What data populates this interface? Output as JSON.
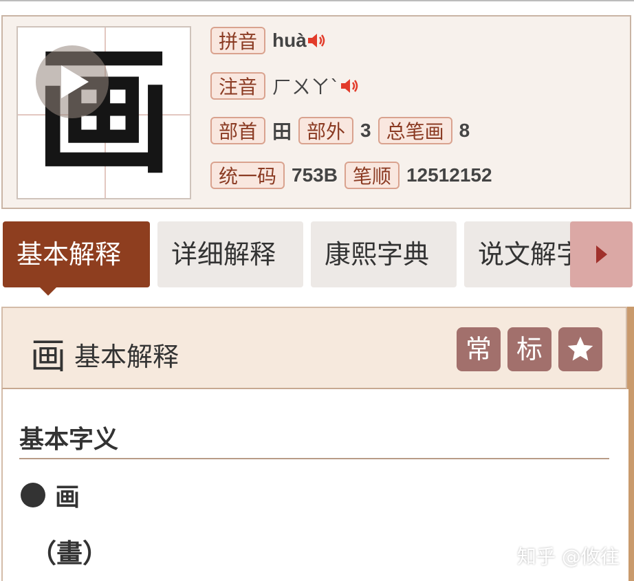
{
  "character": {
    "glyph": "画",
    "pinyin_label": "拼音",
    "pinyin": "huà",
    "zhuyin_label": "注音",
    "zhuyin": "ㄏㄨㄚˋ",
    "radical_label": "部首",
    "radical": "田",
    "outer_strokes_label": "部外",
    "outer_strokes": "3",
    "total_strokes_label": "总笔画",
    "total_strokes": "8",
    "unicode_label": "统一码",
    "unicode": "753B",
    "stroke_order_label": "笔顺",
    "stroke_order": "12512152"
  },
  "tabs": [
    {
      "label": "基本解释",
      "active": true
    },
    {
      "label": "详细解释",
      "active": false
    },
    {
      "label": "康熙字典",
      "active": false
    },
    {
      "label": "说文解字",
      "active": false
    }
  ],
  "section": {
    "char": "画",
    "title": "基本解释",
    "badge_common": "常",
    "badge_standard": "标",
    "favorite_icon": "star-icon"
  },
  "content": {
    "subtitle": "基本字义",
    "entry": "画",
    "traditional": "（畫）"
  },
  "watermark": "知乎 @攸往",
  "colors": {
    "accent": "#8e3e1f",
    "tag_border": "#d9a28e",
    "speaker": "#e23b2a",
    "badge": "#a2706c"
  }
}
